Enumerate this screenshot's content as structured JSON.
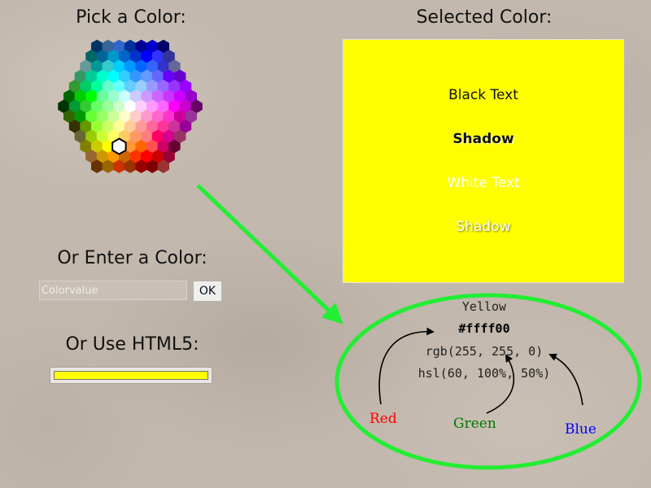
{
  "headings": {
    "pick": "Pick a Color:",
    "selected": "Selected Color:",
    "enter": "Or Enter a Color:",
    "html5": "Or Use HTML5:"
  },
  "palette": {
    "selected_color": "#ffcc00",
    "rows": [
      [
        "#003366",
        "#336699",
        "#3366cc",
        "#003399",
        "#000099",
        "#0000cc",
        "#000066"
      ],
      [
        "#006666",
        "#006699",
        "#0099cc",
        "#0066cc",
        "#0033cc",
        "#0000ff",
        "#3333ff",
        "#333399"
      ],
      [
        "#669999",
        "#009999",
        "#33cccc",
        "#00ccff",
        "#0099ff",
        "#0066ff",
        "#3366ff",
        "#3333cc",
        "#666699"
      ],
      [
        "#339966",
        "#00cc99",
        "#00ffcc",
        "#00ffff",
        "#33ccff",
        "#3399ff",
        "#6699ff",
        "#6666ff",
        "#6600ff",
        "#6600cc"
      ],
      [
        "#339933",
        "#00cc66",
        "#00ff99",
        "#66ffcc",
        "#66ffff",
        "#66ccff",
        "#99ccff",
        "#9999ff",
        "#9966ff",
        "#9933ff",
        "#9900ff"
      ],
      [
        "#006600",
        "#00cc00",
        "#00ff00",
        "#66ff99",
        "#99ffcc",
        "#ccffff",
        "#ccccff",
        "#cc99ff",
        "#cc66ff",
        "#cc33ff",
        "#cc00ff",
        "#9900cc"
      ],
      [
        "#003300",
        "#009933",
        "#33cc33",
        "#66ff66",
        "#99ff99",
        "#ccffcc",
        "#ffffff",
        "#ffccff",
        "#ff99ff",
        "#ff66ff",
        "#ff00ff",
        "#cc00cc",
        "#660066"
      ],
      [
        "#336600",
        "#009900",
        "#66ff33",
        "#99ff66",
        "#ccff99",
        "#ffffcc",
        "#ffcccc",
        "#ff99cc",
        "#ff66cc",
        "#ff33cc",
        "#cc0099",
        "#993399"
      ],
      [
        "#333300",
        "#669900",
        "#99ff33",
        "#ccff66",
        "#ffff99",
        "#ffcc99",
        "#ff9999",
        "#ff6699",
        "#ff3399",
        "#cc3399",
        "#990099"
      ],
      [
        "#666633",
        "#99cc00",
        "#ccff33",
        "#ffff66",
        "#ffcc66",
        "#ff9966",
        "#ff7c80",
        "#ff0066",
        "#d60093",
        "#993366"
      ],
      [
        "#808000",
        "#cccc00",
        "#ffff00",
        "#ffcc00",
        "#ff9933",
        "#ff6600",
        "#ff5050",
        "#cc0066",
        "#660033"
      ],
      [
        "#996633",
        "#cc9900",
        "#ff9900",
        "#cc6600",
        "#ff3300",
        "#ff0000",
        "#cc0000",
        "#990033"
      ],
      [
        "#663300",
        "#996600",
        "#cc3300",
        "#993300",
        "#990000",
        "#800000",
        "#993333"
      ]
    ]
  },
  "input": {
    "placeholder": "Colorvalue",
    "value": ""
  },
  "ok_button": {
    "label": "OK"
  },
  "html5_picker": {
    "value": "#ffff00"
  },
  "preview": {
    "background": "#ffff00",
    "black_text": "Black Text",
    "black_shadow": "Shadow",
    "white_text": "White Text",
    "white_shadow": "Shadow"
  },
  "info": {
    "name": "Yellow",
    "hex": "#ffff00",
    "rgb": "rgb(255, 255, 0)",
    "hsl": "hsl(60, 100%, 50%)"
  },
  "channels": {
    "red": {
      "label": "Red",
      "color": "#ff0000"
    },
    "green": {
      "label": "Green",
      "color": "#007700"
    },
    "blue": {
      "label": "Blue",
      "color": "#0000ff"
    }
  },
  "annotation_color": "#22ee33"
}
